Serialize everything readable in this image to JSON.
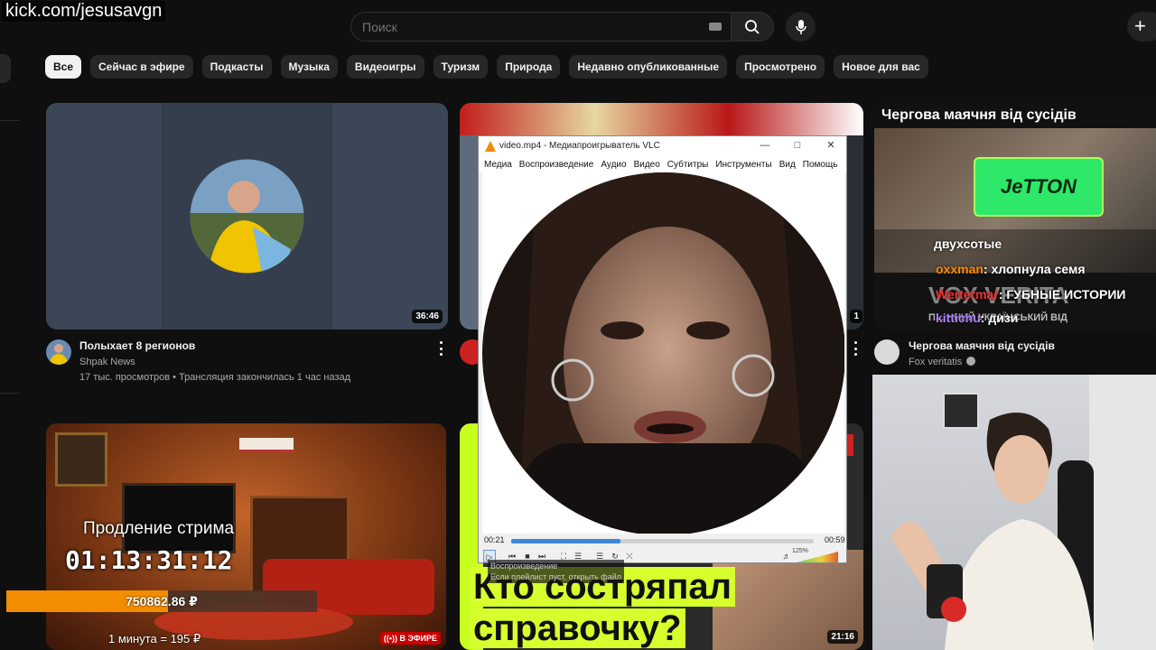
{
  "overlay": {
    "watermark": "kick.com/jesusavgn"
  },
  "header": {
    "search_placeholder": "Поиск",
    "icons": [
      "keyboard-icon",
      "search-icon",
      "mic-icon",
      "plus-icon"
    ]
  },
  "chips": [
    "Все",
    "Сейчас в эфире",
    "Подкасты",
    "Музыка",
    "Видеоигры",
    "Туризм",
    "Природа",
    "Недавно опубликованные",
    "Просмотрено",
    "Новое для вас"
  ],
  "videos": [
    {
      "title": "Полыхает 8 регионов",
      "channel": "Shpak News",
      "stats": "17 тыс. просмотров • Трансляция закончилась 1 час назад",
      "duration": "36:46"
    },
    {
      "duration_partial": "1"
    },
    {
      "title": "Чергова маячня від сусідів",
      "channel": "Fox veritatis",
      "thumb_caption": "Чергова маячня від сусідів",
      "jetton": "JeTTON",
      "chat": [
        {
          "user": "",
          "text": "двухсотые"
        },
        {
          "user": "oxxman",
          "text": ": хлопнула семя"
        },
        {
          "user": "Wertermar",
          "text": ": ГУБНЫЕ ИСТОРИИ"
        },
        {
          "user": "kittichu",
          "text": ": дизи"
        }
      ],
      "vox": "VOX VERITA",
      "ukr_line": "П... ННИЙ УКРАЇНСЬКИЙ ВІД"
    },
    {
      "live_badge": "В ЭФИРЕ"
    },
    {
      "duration": "21:16",
      "big_title": [
        "Кто состряпал",
        "справочку?"
      ]
    }
  ],
  "stream_overlay": {
    "extension_label": "Продление стрима",
    "timer": "01:13:31:12",
    "donation_amount": "750862.86 ₽",
    "donation_progress": 0.52,
    "rate": "1 минута = 195 ₽"
  },
  "vlc": {
    "title": "video.mp4 - Медиапроигрыватель VLC",
    "menu": [
      "Медиа",
      "Воспроизведение",
      "Аудио",
      "Видео",
      "Субтитры",
      "Инструменты",
      "Вид",
      "Помощь"
    ],
    "time_current": "00:21",
    "time_total": "00:59",
    "progress": 0.36,
    "volume_label": "125%",
    "tooltip_title": "Воспроизведение",
    "tooltip_text": "Если плейлист пуст, открыть файл"
  },
  "colors": {
    "accent": "#f28c00",
    "live": "#cc0000",
    "progress": "#3d87d9",
    "yellow_title": "#d7ff2e"
  }
}
